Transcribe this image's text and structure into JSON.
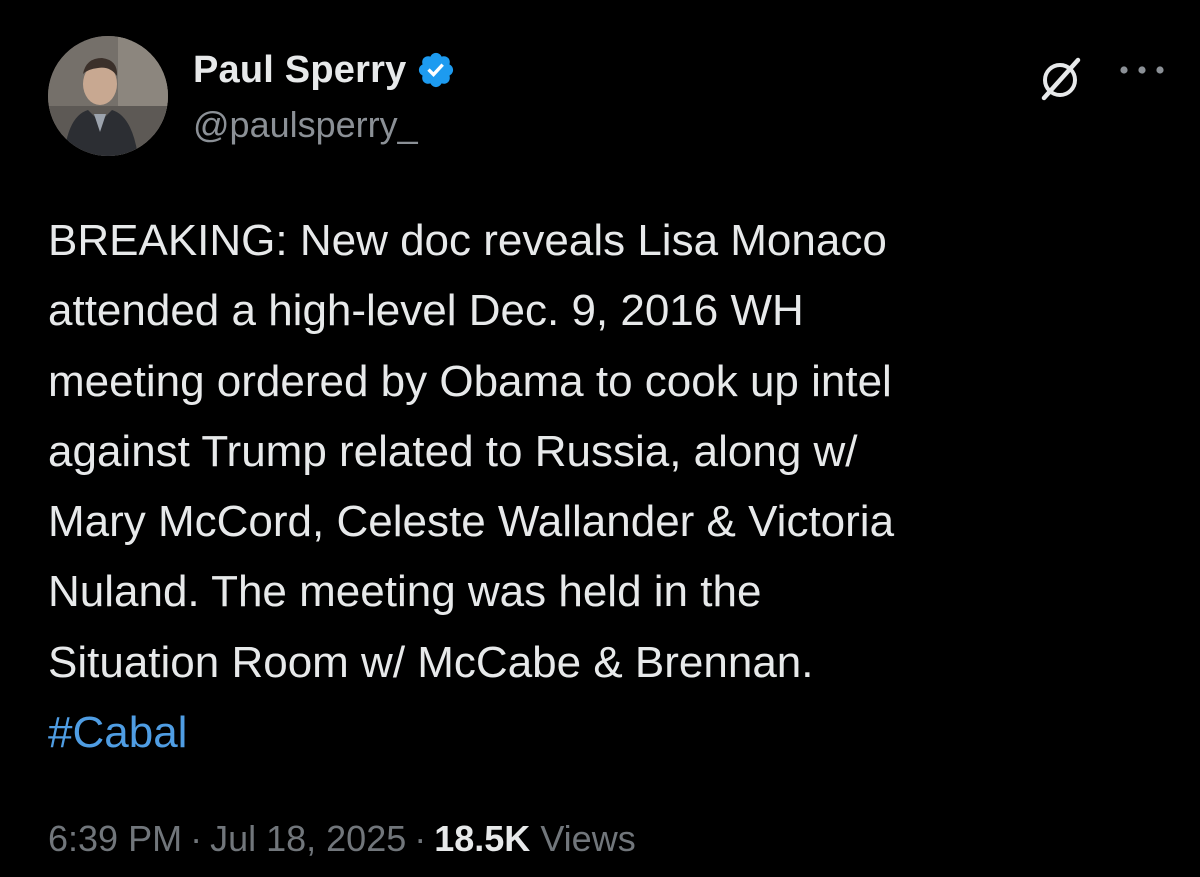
{
  "author": {
    "display_name": "Paul Sperry",
    "handle": "@paulsperry_",
    "verified": true,
    "verified_color": "#1d9bf0"
  },
  "tweet": {
    "lines": [
      "BREAKING: New doc reveals Lisa Monaco",
      "attended a high-level Dec. 9, 2016 WH",
      "meeting ordered by Obama to cook up intel",
      "against Trump related to Russia, along w/",
      "Mary McCord, Celeste Wallander & Victoria",
      "Nuland. The meeting was held in the",
      "Situation Room w/ McCabe & Brennan."
    ],
    "hashtag": "#Cabal",
    "hashtag_color": "#4f9de3"
  },
  "meta": {
    "time": "6:39 PM",
    "separator": "·",
    "date": "Jul 18, 2025",
    "views_count": "18.5K",
    "views_label": "Views"
  },
  "icons": {
    "verified": "verified-badge-icon",
    "grok": "grok-icon",
    "more": "more-options-icon"
  }
}
